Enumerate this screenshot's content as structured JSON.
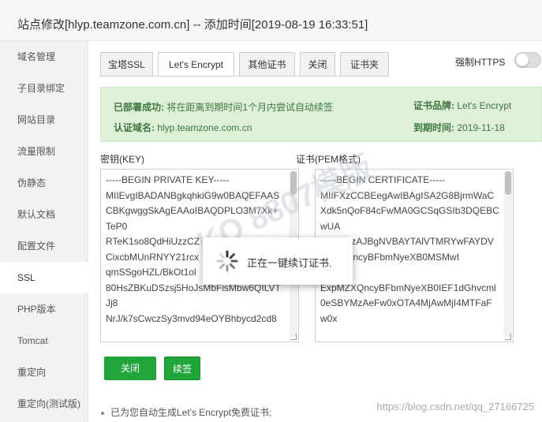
{
  "window": {
    "title": "站点修改[hlyp.teamzone.com.cn] -- 添加时间[2019-08-19 16:33:51]"
  },
  "sidebar": {
    "items": [
      {
        "label": "域名管理"
      },
      {
        "label": "子目录绑定"
      },
      {
        "label": "网站目录"
      },
      {
        "label": "流量限制"
      },
      {
        "label": "伪静态"
      },
      {
        "label": "默认文档"
      },
      {
        "label": "配置文件"
      },
      {
        "label": "SSL"
      },
      {
        "label": "PHP版本"
      },
      {
        "label": "Tomcat"
      },
      {
        "label": "重定向"
      },
      {
        "label": "重定向(测试版)"
      }
    ],
    "active_index": 7
  },
  "tabs": [
    {
      "label": "宝塔SSL"
    },
    {
      "label": "Let's Encrypt"
    },
    {
      "label": "其他证书"
    },
    {
      "label": "关闭"
    },
    {
      "label": "证书夹"
    }
  ],
  "force_https": {
    "label": "强制HTTPS",
    "enabled": false
  },
  "status": {
    "deployed_key": "已部署成功:",
    "deployed_value": "将在距离到期时间1个月内尝试自动续签",
    "domain_key": "认证域名:",
    "domain_value": "hlyp.teamzone.com.cn",
    "brand_key": "证书品牌:",
    "brand_value": "Let's Encrypt",
    "expire_key": "到期时间:",
    "expire_value": "2019-11-18"
  },
  "key_field": {
    "label": "密钥(KEY)",
    "value": "-----BEGIN PRIVATE KEY-----\nMIIEvgIBADANBgkqhkiG9w0BAQEFAAS\nCBKgwggSkAgEAAoIBAQDPLO3M7Xk+\nTeP0\nRTeK1so8QdHiUzzCZ\nCixcbMUnRNYY21rcx\nqmSSgoHZL/BkOt1ol\n80HsZBKuDSzsj5HoJsMbFisMbw6QILVT\nJj8\nNrJ/k7sCwczSy3mvd94eOYBhbycd2cd8"
  },
  "cert_field": {
    "label": "证书(PEM格式)",
    "value": "-----BEGIN CERTIFICATE-----\nMIIFXzCCBEegAwIBAgISA2G8BjrmWaC\nXdk5nQoF84cFwMA0GCSqGSIb3DQEBC\nwUA\nMEoxCzAJBgNVBAYTAlVTMRYwFAYDV\n1MZXQncyBFbmNyeXB0MSMwI\nQD\nExpMZXQncyBFbmNyeXB0IEF1dGhvcml\n0eSBYMzAeFw0xOTA4MjAwMjI4MTFaF\nw0x"
  },
  "buttons": {
    "close_ssl": "关闭SSL",
    "renew": "续签"
  },
  "note": "已为您自动生成Let's Encrypt免费证书;",
  "loading": {
    "message": "正在一键续订证书."
  },
  "watermarks": {
    "url": "https://blog.csdn.net/qq_27166725",
    "logo": "KO 8807模版"
  },
  "colors": {
    "primary_green": "#20a53a",
    "info_bg": "#dff0d8",
    "info_text": "#3c763d"
  }
}
